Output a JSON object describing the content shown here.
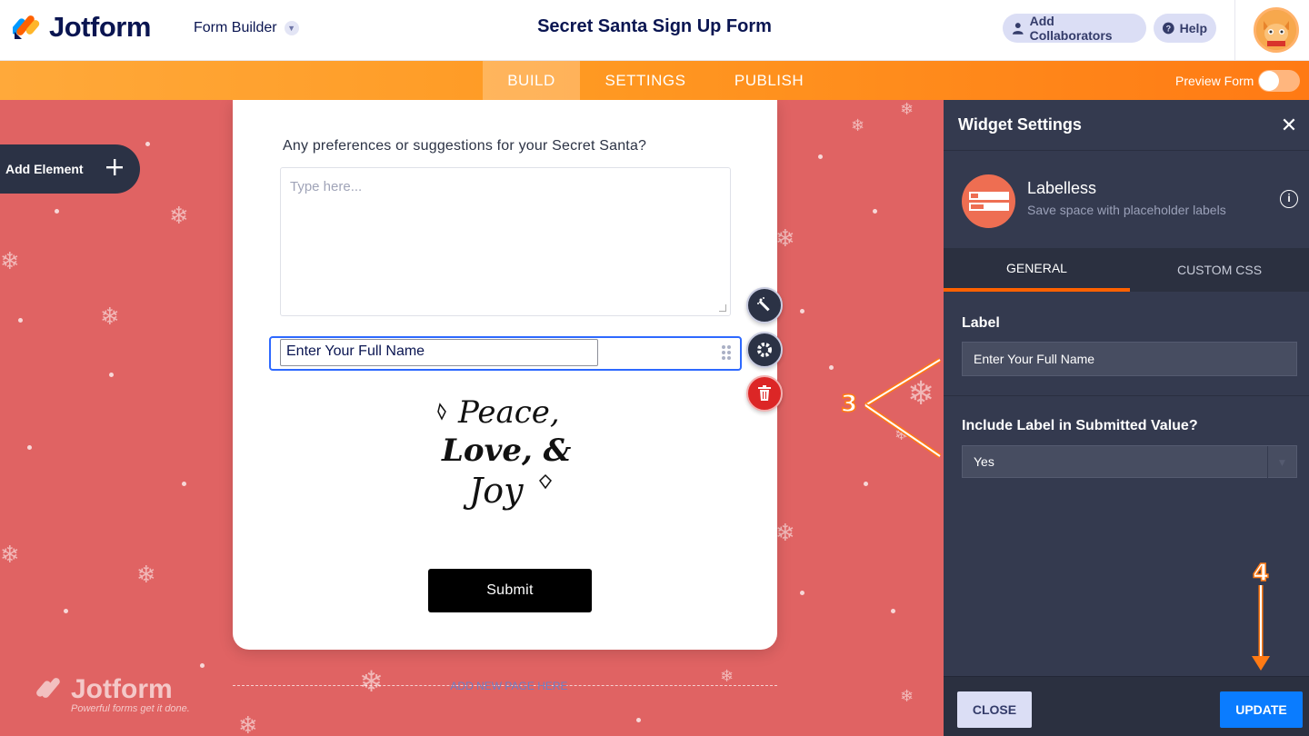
{
  "header": {
    "logo_text": "Jotform",
    "builder_label": "Form Builder",
    "form_title": "Secret Santa Sign Up Form",
    "add_collaborators": "Add Collaborators",
    "help": "Help"
  },
  "nav": {
    "tabs": [
      "BUILD",
      "SETTINGS",
      "PUBLISH"
    ],
    "active_tab": "BUILD",
    "preview_label": "Preview Form",
    "preview_on": false
  },
  "canvas": {
    "add_element": "Add Element",
    "question_label": "Any preferences or suggestions for your Secret Santa?",
    "textarea_placeholder": "Type here...",
    "name_field_value": "Enter Your Full Name",
    "submit_label": "Submit",
    "add_new_page": "ADD NEW PAGE HERE",
    "watermark_title": "Jotform",
    "watermark_sub": "Powerful forms get it done.",
    "background_color": "#e06363"
  },
  "image": {
    "line1": "Peace,",
    "line2": "Love, &",
    "line3": "Joy"
  },
  "panel": {
    "title": "Widget Settings",
    "widget_name": "Labelless",
    "widget_desc": "Save space with placeholder labels",
    "tabs": [
      "GENERAL",
      "CUSTOM CSS"
    ],
    "active_tab": "GENERAL",
    "label_title": "Label",
    "label_value": "Enter Your Full Name",
    "include_title": "Include Label in Submitted Value?",
    "include_value": "Yes",
    "close_label": "CLOSE",
    "update_label": "UPDATE"
  },
  "annotations": {
    "step3": "3",
    "step4": "4",
    "arrow_color": "#ff7a14"
  },
  "colors": {
    "accent_orange": "#ff7a14",
    "brand_navy": "#0a1551",
    "update_blue": "#0a7cff",
    "selection_blue": "#2e69ff"
  }
}
